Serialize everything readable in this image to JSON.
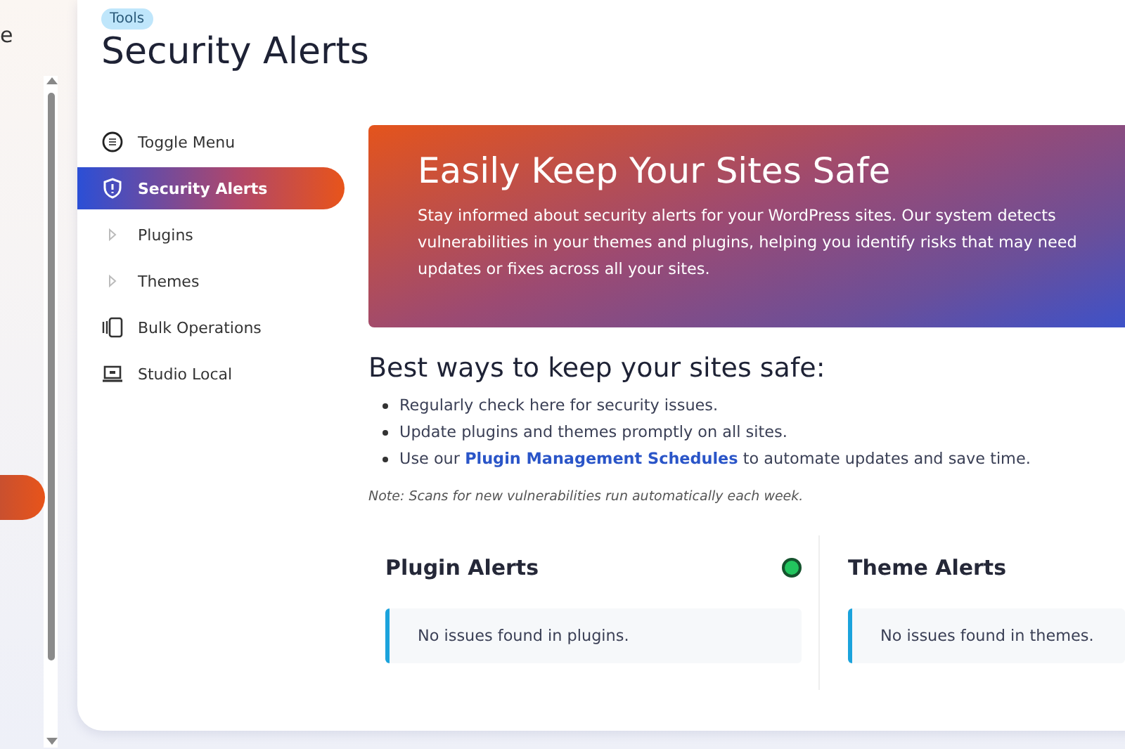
{
  "background_window": {
    "text_fragment": "e"
  },
  "page": {
    "badge": "Tools",
    "title": "Security Alerts"
  },
  "sidebar": {
    "items": [
      {
        "label": "Toggle Menu",
        "kind": "toggle",
        "selected": false
      },
      {
        "label": "Security Alerts",
        "kind": "shield",
        "selected": true
      },
      {
        "label": "Plugins",
        "kind": "expand",
        "selected": false
      },
      {
        "label": "Themes",
        "kind": "expand",
        "selected": false
      },
      {
        "label": "Bulk Operations",
        "kind": "bulk",
        "selected": false
      },
      {
        "label": "Studio Local",
        "kind": "laptop",
        "selected": false
      }
    ]
  },
  "banner": {
    "title": "Easily Keep Your Sites Safe",
    "text": "Stay informed about security alerts for your WordPress sites. Our system detects vulnerabilities in your themes and plugins, helping you identify risks that may need updates or fixes across all your sites."
  },
  "tips": {
    "heading": "Best ways to keep your sites safe:",
    "items": [
      {
        "text": "Regularly check here for security issues."
      },
      {
        "text": "Update plugins and themes promptly on all sites."
      },
      {
        "before": "Use our ",
        "link": "Plugin Management Schedules",
        "after": " to automate updates and save time."
      }
    ],
    "note": "Note: Scans for new vulnerabilities run automatically each week."
  },
  "alert_panels": [
    {
      "title": "Plugin Alerts",
      "color": "#22c55e",
      "message": "No issues found in plugins."
    },
    {
      "title": "Theme Alerts",
      "message": "No issues found in themes."
    }
  ]
}
